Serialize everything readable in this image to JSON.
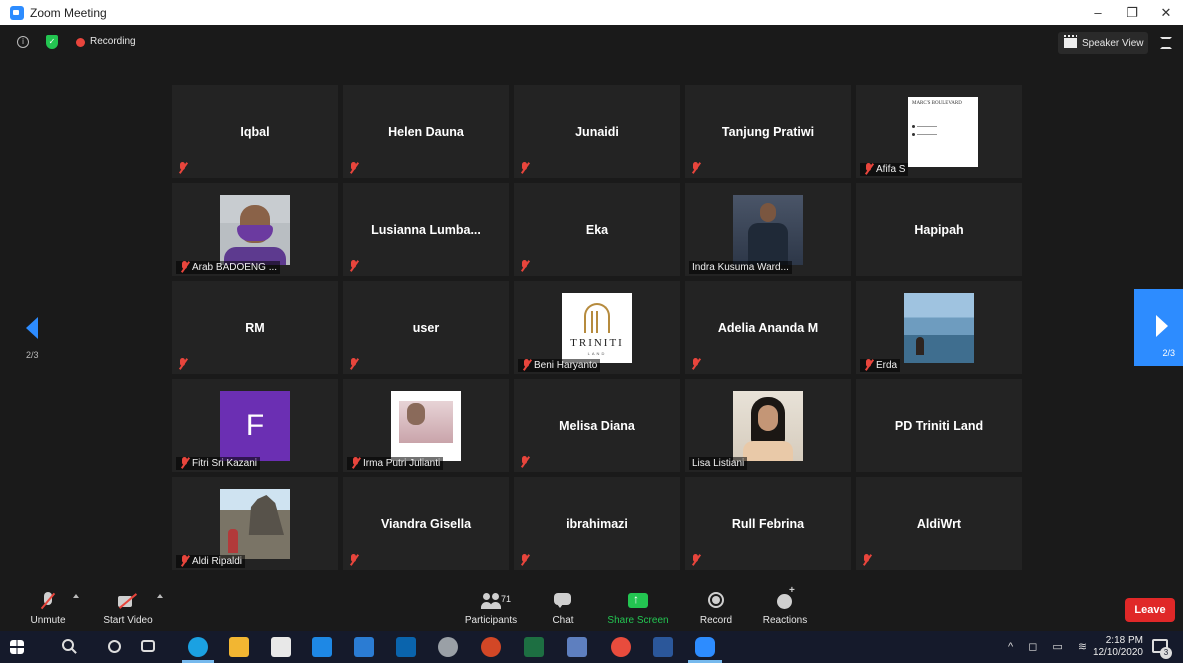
{
  "window": {
    "title": "Zoom Meeting",
    "buttons": [
      "–",
      "❐",
      "✕"
    ]
  },
  "top": {
    "recording_label": "Recording",
    "speaker_view_label": "Speaker View"
  },
  "participants": [
    {
      "name": "Iqbal",
      "label": "",
      "muted": true
    },
    {
      "name": "Helen Dauna",
      "label": "",
      "muted": true
    },
    {
      "name": "Junaidi",
      "label": "",
      "muted": true
    },
    {
      "name": "Tanjung Pratiwi",
      "label": "",
      "muted": true
    },
    {
      "name": "",
      "label": "Afifa S",
      "muted": true
    },
    {
      "name": "",
      "label": "Arab BADOENG ...",
      "muted": true
    },
    {
      "name": "Lusianna  Lumba...",
      "label": "",
      "muted": true
    },
    {
      "name": "Eka",
      "label": "",
      "muted": true
    },
    {
      "name": "",
      "label": "Indra Kusuma Ward...",
      "muted": false
    },
    {
      "name": "Hapipah",
      "label": "",
      "muted": false
    },
    {
      "name": "RM",
      "label": "",
      "muted": true
    },
    {
      "name": "user",
      "label": "",
      "muted": true
    },
    {
      "name": "",
      "label": "Beni Haryanto",
      "muted": true
    },
    {
      "name": "Adelia Ananda M",
      "label": "",
      "muted": true
    },
    {
      "name": "",
      "label": "Erda",
      "muted": true
    },
    {
      "name": "",
      "label": "Fitri Sri Kazani",
      "muted": true
    },
    {
      "name": "",
      "label": "Irma Putri Julianti",
      "muted": true
    },
    {
      "name": "Melisa Diana",
      "label": "",
      "muted": true
    },
    {
      "name": "",
      "label": "Lisa Listiani",
      "muted": false
    },
    {
      "name": "PD Triniti Land",
      "label": "",
      "muted": false
    },
    {
      "name": "",
      "label": "Aldi Ripaldi",
      "muted": true
    },
    {
      "name": "Viandra Gisella",
      "label": "",
      "muted": true
    },
    {
      "name": "ibrahimazi",
      "label": "",
      "muted": true
    },
    {
      "name": "Rull Febrina",
      "label": "",
      "muted": true
    },
    {
      "name": "AldiWrt",
      "label": "",
      "muted": true
    }
  ],
  "tile_text": {
    "afifa_title": "MARC'S BOULEVARD",
    "beni_logo": "TRINITI",
    "beni_logo_sub": "LAND",
    "fitri_initial": "F"
  },
  "pagination": {
    "left": "2/3",
    "right": "2/3"
  },
  "toolbar": {
    "unmute": "Unmute",
    "start_video": "Start Video",
    "participants": "Participants",
    "participants_count": "71",
    "chat": "Chat",
    "share_screen": "Share Screen",
    "record": "Record",
    "reactions": "Reactions",
    "leave": "Leave"
  },
  "taskbar": {
    "time": "2:18 PM",
    "date": "12/10/2020",
    "notifications": "3"
  },
  "colors": {
    "accent": "#2d8cff",
    "mute_red": "#e8453c",
    "share_green": "#23c551",
    "leave_red": "#e02828"
  }
}
